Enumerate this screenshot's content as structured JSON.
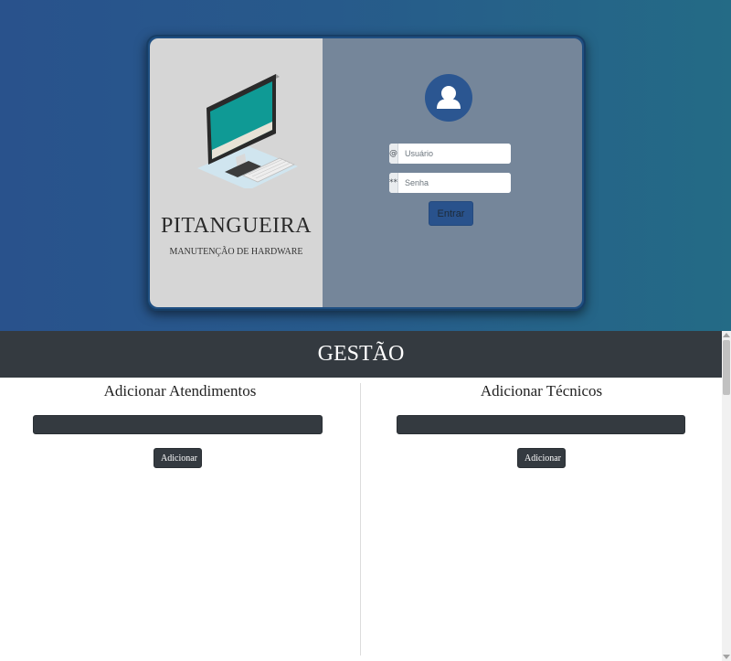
{
  "login": {
    "brand_title": "PITANGUEIRA",
    "brand_subtitle": "MANUTENÇÃO DE HARDWARE",
    "user_icon": "@",
    "user_placeholder": "Usuário",
    "pass_icon": "**",
    "pass_placeholder": "Senha",
    "submit_label": "Entrar"
  },
  "gestao": {
    "title": "GESTÃO"
  },
  "panels": {
    "atendimentos": {
      "title": "Adicionar Atendimentos",
      "input_value": "",
      "button_label": "Adicionar"
    },
    "tecnicos": {
      "title": "Adicionar Técnicos",
      "input_value": "",
      "button_label": "Adicionar"
    }
  },
  "icons": {
    "illustration": "desktop-computer-icon",
    "avatar": "user-avatar-icon"
  },
  "colors": {
    "hero_gradient_start": "#29528c",
    "hero_gradient_end": "#246b86",
    "card_left_bg": "#d6d6d6",
    "card_right_bg": "#75869a",
    "accent": "#29528c",
    "dark_bar": "#343a40"
  }
}
